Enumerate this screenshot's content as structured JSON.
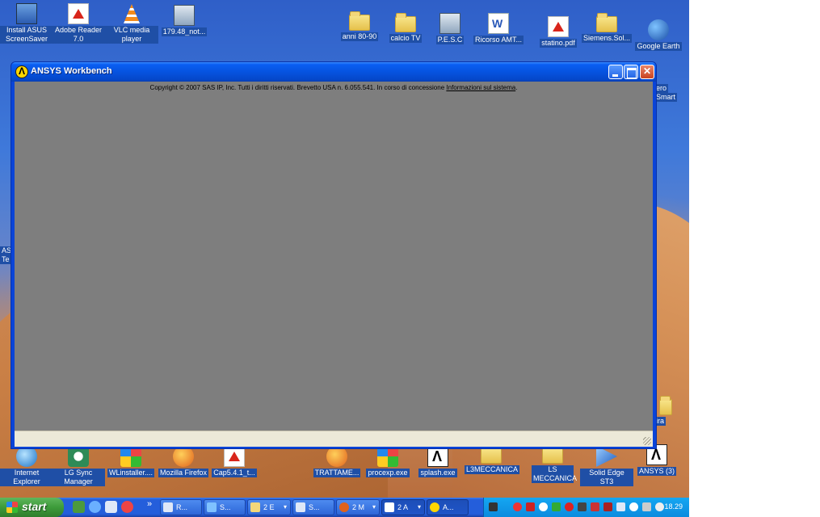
{
  "desktop": {
    "icons": [
      {
        "label": "Install ASUS ScreenSaver",
        "icon": "setup-icon"
      },
      {
        "label": "Adobe Reader 7.0",
        "icon": "pdf-icon"
      },
      {
        "label": "VLC media player",
        "icon": "vlc-icon"
      },
      {
        "label": "179.48_not...",
        "icon": "app-icon"
      },
      {
        "label": "anni 80-90",
        "icon": "folder-icon"
      },
      {
        "label": "calcio TV",
        "icon": "folder-icon"
      },
      {
        "label": "P.E.S.C",
        "icon": "app-icon"
      },
      {
        "label": "Ricorso AMT...",
        "icon": "doc-icon"
      },
      {
        "label": "statino.pdf",
        "icon": "pdf-icon"
      },
      {
        "label": "Siemens.Sol...",
        "icon": "folder-icon"
      },
      {
        "label": "Google Earth",
        "icon": "earth-icon"
      },
      {
        "label": "Internet Explorer",
        "icon": "ie-icon"
      },
      {
        "label": "LG Sync Manager",
        "icon": "green-icon"
      },
      {
        "label": "WLinstaller....",
        "icon": "windows-icon"
      },
      {
        "label": "Mozilla Firefox",
        "icon": "firefox-icon"
      },
      {
        "label": "Cap5.4.1_t...",
        "icon": "pdf-icon"
      },
      {
        "label": "TRATTAME...",
        "icon": "firefox-icon"
      },
      {
        "label": "procexp.exe",
        "icon": "windows-icon"
      },
      {
        "label": "splash.exe",
        "icon": "ansys-icon"
      },
      {
        "label": "L3MECCANICA",
        "icon": "folder-icon"
      },
      {
        "label": "LS MECCANICA",
        "icon": "folder-icon"
      },
      {
        "label": "Solid Edge ST3",
        "icon": "edge-icon"
      },
      {
        "label": "ANSYS (3)",
        "icon": "ansys-icon"
      }
    ],
    "partial": {
      "right_top": "ero",
      "right_top2": "Smart",
      "left1": "AS",
      "left2": "Te",
      "right_low": "ira"
    }
  },
  "window": {
    "title": "ANSYS Workbench",
    "copyright": "Copyright © 2007 SAS IP, Inc. Tutti i diritti riservati. Brevetto USA n. 6.055.541. In corso di concessione",
    "system_info_link": "Informazioni sul sistema",
    "period": "."
  },
  "taskbar": {
    "start_label": "start",
    "chevron": "»",
    "tasks": [
      {
        "label": "R...",
        "arrow": ""
      },
      {
        "label": "S...",
        "arrow": ""
      },
      {
        "label": "2 E",
        "arrow": "▾"
      },
      {
        "label": "S...",
        "arrow": ""
      },
      {
        "label": "2 M",
        "arrow": "▾"
      },
      {
        "label": "2 A",
        "arrow": "▾"
      },
      {
        "label": "A...",
        "arrow": ""
      }
    ],
    "clock": "18.29"
  }
}
